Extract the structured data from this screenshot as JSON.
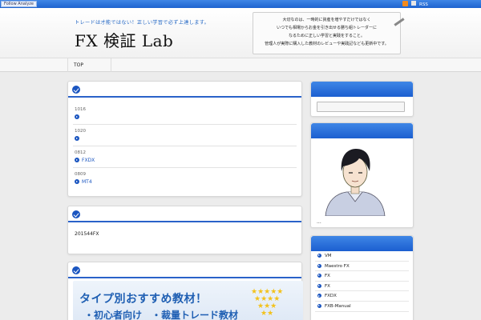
{
  "topbar": {
    "follow_label": "Follow Analyze",
    "rss_label": "RSS"
  },
  "header": {
    "tagline": "トレードは才能ではない！正しい学習で必ず上達します。",
    "title": "FX 検証 Lab",
    "note_lines": [
      "大切なのは、一時的に資産を増やすだけではなく",
      "いつでも相場からお金を引き出せる勝ち組トレーダーに",
      "なるために正しい学習と実践をすること。",
      "管理人が実際に購入した教材のレビューや実践記なども更新中です。"
    ]
  },
  "nav": {
    "top_label": "TOP"
  },
  "recent_posts": [
    {
      "date": "1016",
      "title": ""
    },
    {
      "date": "1020",
      "title": ""
    },
    {
      "date": "0812",
      "title": "FXDX"
    },
    {
      "date": "0809",
      "title": "MT4"
    }
  ],
  "notice_box": {
    "text": "201544FX"
  },
  "banner": {
    "title": "タイプ別おすすめ教材！",
    "subtitle": "・初心者向け　・裁量トレード教材"
  },
  "profile": {
    "caption": "..."
  },
  "categories": [
    "VM",
    "Maestro FX",
    "FX",
    "FX",
    "FXDX",
    "FXB-Manual"
  ],
  "colors": {
    "accent": "#1a55c0",
    "header_blue": "#2a6fde",
    "background": "#ececec"
  }
}
